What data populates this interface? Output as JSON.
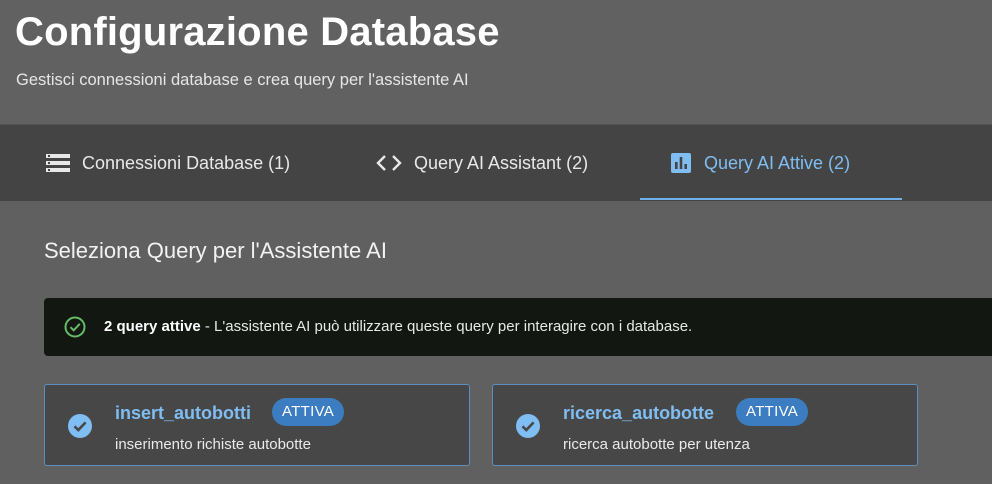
{
  "header": {
    "title": "Configurazione Database",
    "subtitle": "Gestisci connessioni database e crea query per l'assistente AI"
  },
  "tabs": [
    {
      "label": "Connessioni Database (1)",
      "icon": "database-list-icon",
      "active": false
    },
    {
      "label": "Query AI Assistant (2)",
      "icon": "code-icon",
      "active": false
    },
    {
      "label": "Query AI Attive (2)",
      "icon": "bar-chart-icon",
      "active": true
    }
  ],
  "section": {
    "title": "Seleziona Query per l'Assistente AI"
  },
  "alert": {
    "icon": "check-circle-icon",
    "strong": "2 query attive",
    "text": " - L'assistente AI può utilizzare queste query per interagire con i database."
  },
  "queries": [
    {
      "name": "insert_autobotti",
      "badge": "ATTIVA",
      "description": "inserimento richiste autobotte",
      "icon": "check-circle-filled-icon"
    },
    {
      "name": "ricerca_autobotte",
      "badge": "ATTIVA",
      "description": "ricerca autobotte per utenza",
      "icon": "check-circle-filled-icon"
    }
  ],
  "colors": {
    "accent": "#7fbdf2",
    "badge_bg": "#3b7dc0",
    "success": "#66bb6a",
    "alert_bg": "#121712"
  }
}
